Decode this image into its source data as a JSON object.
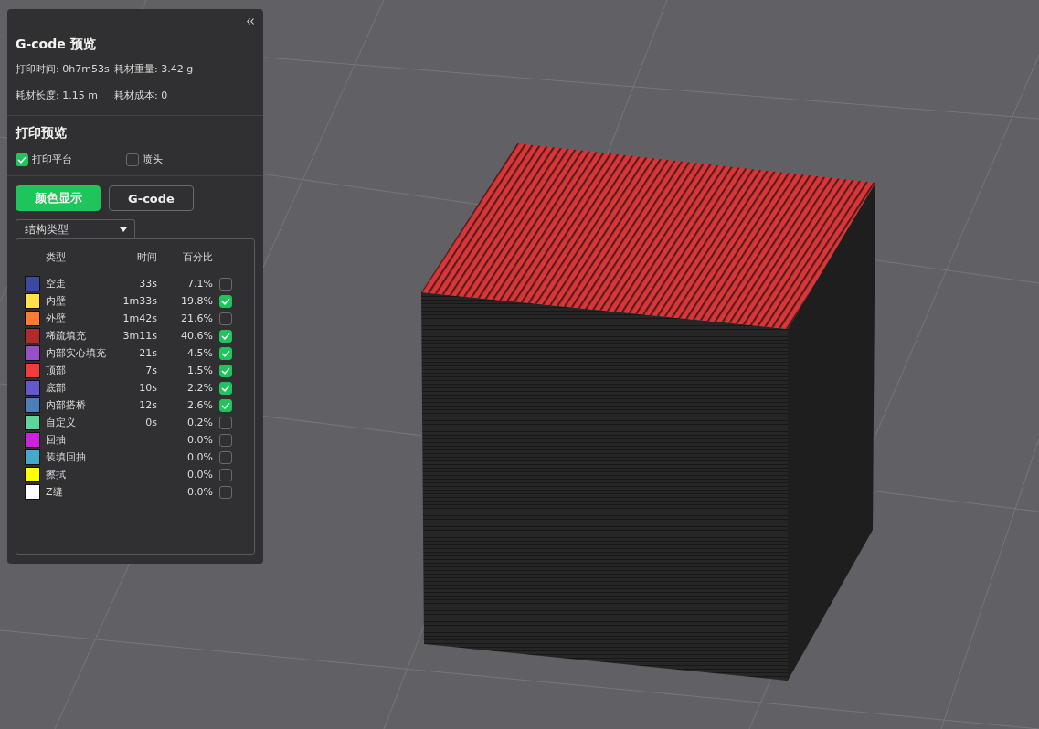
{
  "panel": {
    "title": "G-code 预览",
    "stats": [
      {
        "label": "打印时间: 0h7m53s"
      },
      {
        "label": "耗材重量: 3.42 g"
      },
      {
        "label": "耗材长度: 1.15 m"
      },
      {
        "label": "耗材成本: 0"
      }
    ],
    "preview_title": "打印预览",
    "toggles": [
      {
        "label": "打印平台",
        "checked": true
      },
      {
        "label": "喷头",
        "checked": false
      }
    ],
    "view_buttons": [
      {
        "label": "颜色显示",
        "selected": true
      },
      {
        "label": "G-code",
        "selected": false
      }
    ],
    "dropdown": {
      "value": "结构类型"
    },
    "legend": {
      "columns": [
        "类型",
        "时间",
        "百分比"
      ],
      "rows": [
        {
          "name": "空走",
          "time": "33s",
          "percent": "7.1%",
          "color": "#3b4aa0",
          "checked": false
        },
        {
          "name": "内壁",
          "time": "1m33s",
          "percent": "19.8%",
          "color": "#ffe14d",
          "checked": true
        },
        {
          "name": "外壁",
          "time": "1m42s",
          "percent": "21.6%",
          "color": "#ff7a33",
          "checked": false
        },
        {
          "name": "稀疏填充",
          "time": "3m11s",
          "percent": "40.6%",
          "color": "#b22b2b",
          "checked": true
        },
        {
          "name": "内部实心填充",
          "time": "21s",
          "percent": "4.5%",
          "color": "#9650c8",
          "checked": true
        },
        {
          "name": "顶部",
          "time": "7s",
          "percent": "1.5%",
          "color": "#f03c3c",
          "checked": true
        },
        {
          "name": "底部",
          "time": "10s",
          "percent": "2.2%",
          "color": "#6459c8",
          "checked": true
        },
        {
          "name": "内部搭桥",
          "time": "12s",
          "percent": "2.6%",
          "color": "#4b7fba",
          "checked": true
        },
        {
          "name": "自定义",
          "time": "0s",
          "percent": "0.2%",
          "color": "#5cd69a",
          "checked": false
        },
        {
          "name": "回抽",
          "percent": "0.0%",
          "color": "#cc22dd",
          "checked": false
        },
        {
          "name": "装填回抽",
          "percent": "0.0%",
          "color": "#44aacc",
          "checked": false
        },
        {
          "name": "擦拭",
          "percent": "0.0%",
          "color": "#ffff00",
          "checked": false
        },
        {
          "name": "Z缝",
          "percent": "0.0%",
          "color": "#ffffff",
          "checked": false
        }
      ]
    }
  }
}
